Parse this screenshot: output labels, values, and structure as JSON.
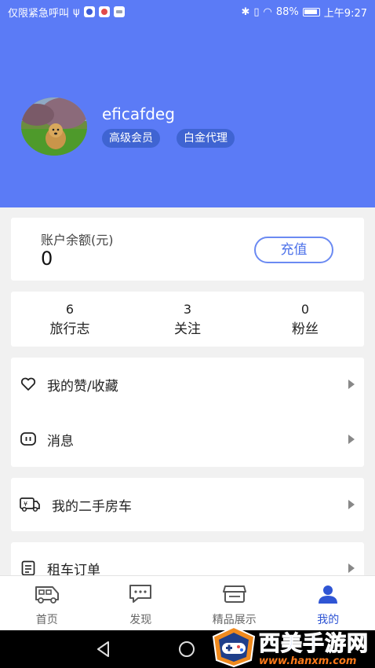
{
  "status_bar": {
    "carrier": "仅限紧急呼叫",
    "battery": "88%",
    "time": "上午9:27"
  },
  "profile": {
    "username": "eficafdeg",
    "tags": [
      "高级会员",
      "白金代理"
    ]
  },
  "balance": {
    "label": "账户余额(元)",
    "value": "0",
    "recharge_label": "充值"
  },
  "stats": [
    {
      "count": "6",
      "label": "旅行志"
    },
    {
      "count": "3",
      "label": "关注"
    },
    {
      "count": "0",
      "label": "粉丝"
    }
  ],
  "menu": {
    "likes": {
      "label": "我的赞/收藏",
      "icon": "heart-icon"
    },
    "messages": {
      "label": "消息",
      "icon": "message-icon"
    },
    "used_rv": {
      "label": "我的二手房车",
      "icon": "rv-trade-icon"
    },
    "rental_orders": {
      "label": "租车订单",
      "icon": "order-icon"
    }
  },
  "bottom_nav": [
    {
      "label": "首页",
      "icon": "rv-home-icon",
      "active": false
    },
    {
      "label": "发现",
      "icon": "chat-discover-icon",
      "active": false
    },
    {
      "label": "精品展示",
      "icon": "showcase-icon",
      "active": false
    },
    {
      "label": "我的",
      "icon": "person-icon",
      "active": true
    }
  ],
  "watermark": {
    "title": "西美手游网",
    "url": "www.hanxm.com"
  },
  "colors": {
    "header": "#5b7bf6",
    "accent": "#2f55d4",
    "tag_bg": "#3f64d2"
  }
}
